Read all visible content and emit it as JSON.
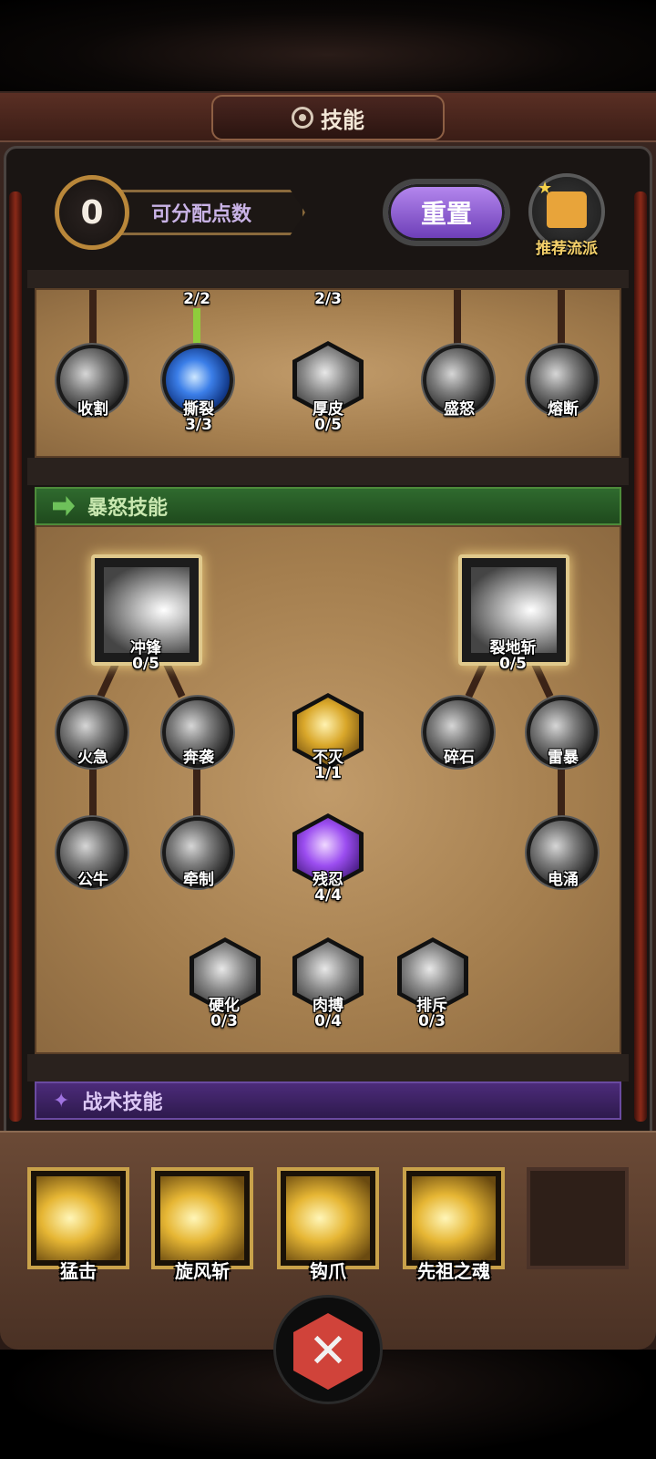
{
  "header": {
    "title": "技能",
    "available_points": "0",
    "available_points_label": "可分配点数",
    "reset_label": "重置",
    "recommend_label": "推荐流派"
  },
  "upper_tree": {
    "top_counts": [
      "2/2",
      "2/3"
    ],
    "skills": [
      {
        "name": "收割",
        "level": ""
      },
      {
        "name": "撕裂",
        "level": "3/3"
      },
      {
        "name": "厚皮",
        "level": "0/5"
      },
      {
        "name": "盛怒",
        "level": ""
      },
      {
        "name": "熔断",
        "level": ""
      }
    ]
  },
  "rage_section": {
    "title": "暴怒技能",
    "main_skills": [
      {
        "name": "冲锋",
        "level": "0/5"
      },
      {
        "name": "裂地斩",
        "level": "0/5"
      }
    ],
    "row1": [
      {
        "name": "火急",
        "level": ""
      },
      {
        "name": "奔袭",
        "level": ""
      },
      {
        "name": "不灭",
        "level": "1/1"
      },
      {
        "name": "碎石",
        "level": ""
      },
      {
        "name": "雷暴",
        "level": ""
      }
    ],
    "row2": [
      {
        "name": "公牛",
        "level": ""
      },
      {
        "name": "牵制",
        "level": ""
      },
      {
        "name": "残忍",
        "level": "4/4"
      },
      {
        "name": "电涌",
        "level": ""
      }
    ],
    "row3": [
      {
        "name": "硬化",
        "level": "0/3"
      },
      {
        "name": "肉搏",
        "level": "0/4"
      },
      {
        "name": "排斥",
        "level": "0/3"
      }
    ]
  },
  "tactic_section": {
    "title": "战术技能"
  },
  "tactic_bar": [
    {
      "name": "猛击"
    },
    {
      "name": "旋风斩"
    },
    {
      "name": "钩爪"
    },
    {
      "name": "先祖之魂"
    }
  ],
  "icons": {
    "title": "gear-icon",
    "recommend": "thumbs-up-icon",
    "rage_section": "boot-icon",
    "tactic_section": "star-icon",
    "bottom": "crossed-swords-icon"
  },
  "colors": {
    "accent_purple": "#8a5ad6",
    "rage_green": "#2f6a2e",
    "tactic_purple": "#4c2b7a",
    "gold": "#e8c26a",
    "learned_line": "#8fcc3c"
  }
}
